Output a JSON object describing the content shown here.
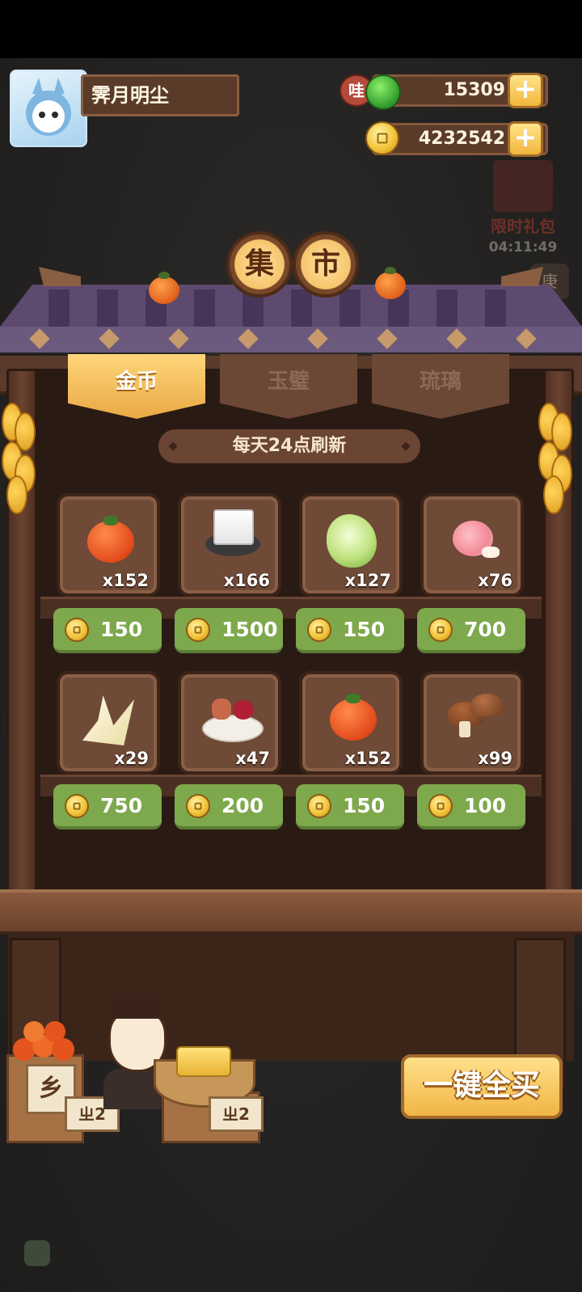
{
  "player": {
    "name": "霁月明尘"
  },
  "currency": {
    "jade": {
      "value": "15309",
      "badge": "哇"
    },
    "coins": {
      "value": "4232542"
    }
  },
  "gift": {
    "label": "限时礼包",
    "timer": "04:11:49",
    "side_label": "庚"
  },
  "title": {
    "char1": "集",
    "char2": "市"
  },
  "tabs": [
    {
      "label": "金币",
      "active": true
    },
    {
      "label": "玉璧",
      "active": false
    },
    {
      "label": "琉璃",
      "active": false
    }
  ],
  "notice": "每天24点刷新",
  "items": [
    {
      "icon": "persimmon-icon",
      "qty": "x152",
      "price": "150"
    },
    {
      "icon": "tofu-icon",
      "qty": "x166",
      "price": "1500"
    },
    {
      "icon": "cabbage-icon",
      "qty": "x127",
      "price": "150"
    },
    {
      "icon": "meat-leg-icon",
      "qty": "x76",
      "price": "700"
    },
    {
      "icon": "bamboo-shoot-icon",
      "qty": "x29",
      "price": "750"
    },
    {
      "icon": "meat-platter-icon",
      "qty": "x47",
      "price": "200"
    },
    {
      "icon": "persimmon-icon",
      "qty": "x152",
      "price": "150"
    },
    {
      "icon": "mushroom-icon",
      "qty": "x99",
      "price": "100"
    }
  ],
  "merchant": {
    "sign_left": "乡",
    "tag_left": "ㄓ2",
    "tag_right": "ㄓ2"
  },
  "buy_all_label": "一键全买",
  "colors": {
    "price_green": "#7ea84c",
    "tab_active": "#f1b545",
    "wood": "#6e4a37"
  }
}
